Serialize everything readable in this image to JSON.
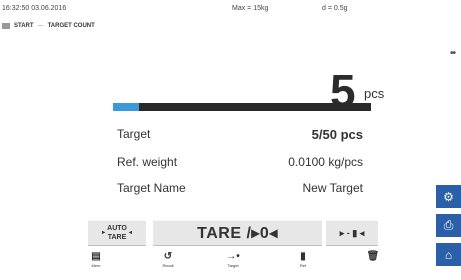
{
  "status": {
    "datetime": "16:32:50 03.06.2016",
    "max": "Max = 15kg",
    "d": "d = 0.5g"
  },
  "breadcrumb": {
    "icon": "balance-icon",
    "start": "START",
    "separator": "—",
    "current": "TARGET COUNT"
  },
  "menu": {
    "icon": "overflow-dots-icon",
    "glyph": "••"
  },
  "display": {
    "value": "5",
    "unit": "pcs"
  },
  "progress": {
    "fraction": 0.1,
    "bar_color": "#2a2a2a",
    "fill_color": "#3a9ad9"
  },
  "info": [
    {
      "label": "Target",
      "value": "5/50 pcs"
    },
    {
      "label": "Ref. weight",
      "value": "0.0100 kg/pcs"
    },
    {
      "label": "Target Name",
      "value": "New Target"
    }
  ],
  "keys": {
    "auto_tare_line1": "AUTO",
    "auto_tare_line2": "TARE",
    "tare": "TARE /▸0◂",
    "ref": "▸ - ▮ ◂"
  },
  "function_keys": [
    {
      "icon": "menu-book-icon",
      "glyph": "▤",
      "label": "Mem"
    },
    {
      "icon": "reset-icon",
      "glyph": "↺",
      "label": "Recall"
    },
    {
      "icon": "target-arrow-icon",
      "glyph": "→•",
      "label": "Target"
    },
    {
      "icon": "ref-weight-icon",
      "glyph": "▮",
      "label": "Ref"
    },
    {
      "icon": "trash-icon",
      "glyph": "🗑",
      "label": ""
    }
  ],
  "side_buttons": [
    {
      "icon": "gear-icon",
      "glyph": "⚙"
    },
    {
      "icon": "printer-icon",
      "glyph": "⎙"
    },
    {
      "icon": "home-icon",
      "glyph": "⌂"
    }
  ],
  "colors": {
    "accent": "#2b5fa8",
    "key_bg": "#e7e7e7"
  }
}
